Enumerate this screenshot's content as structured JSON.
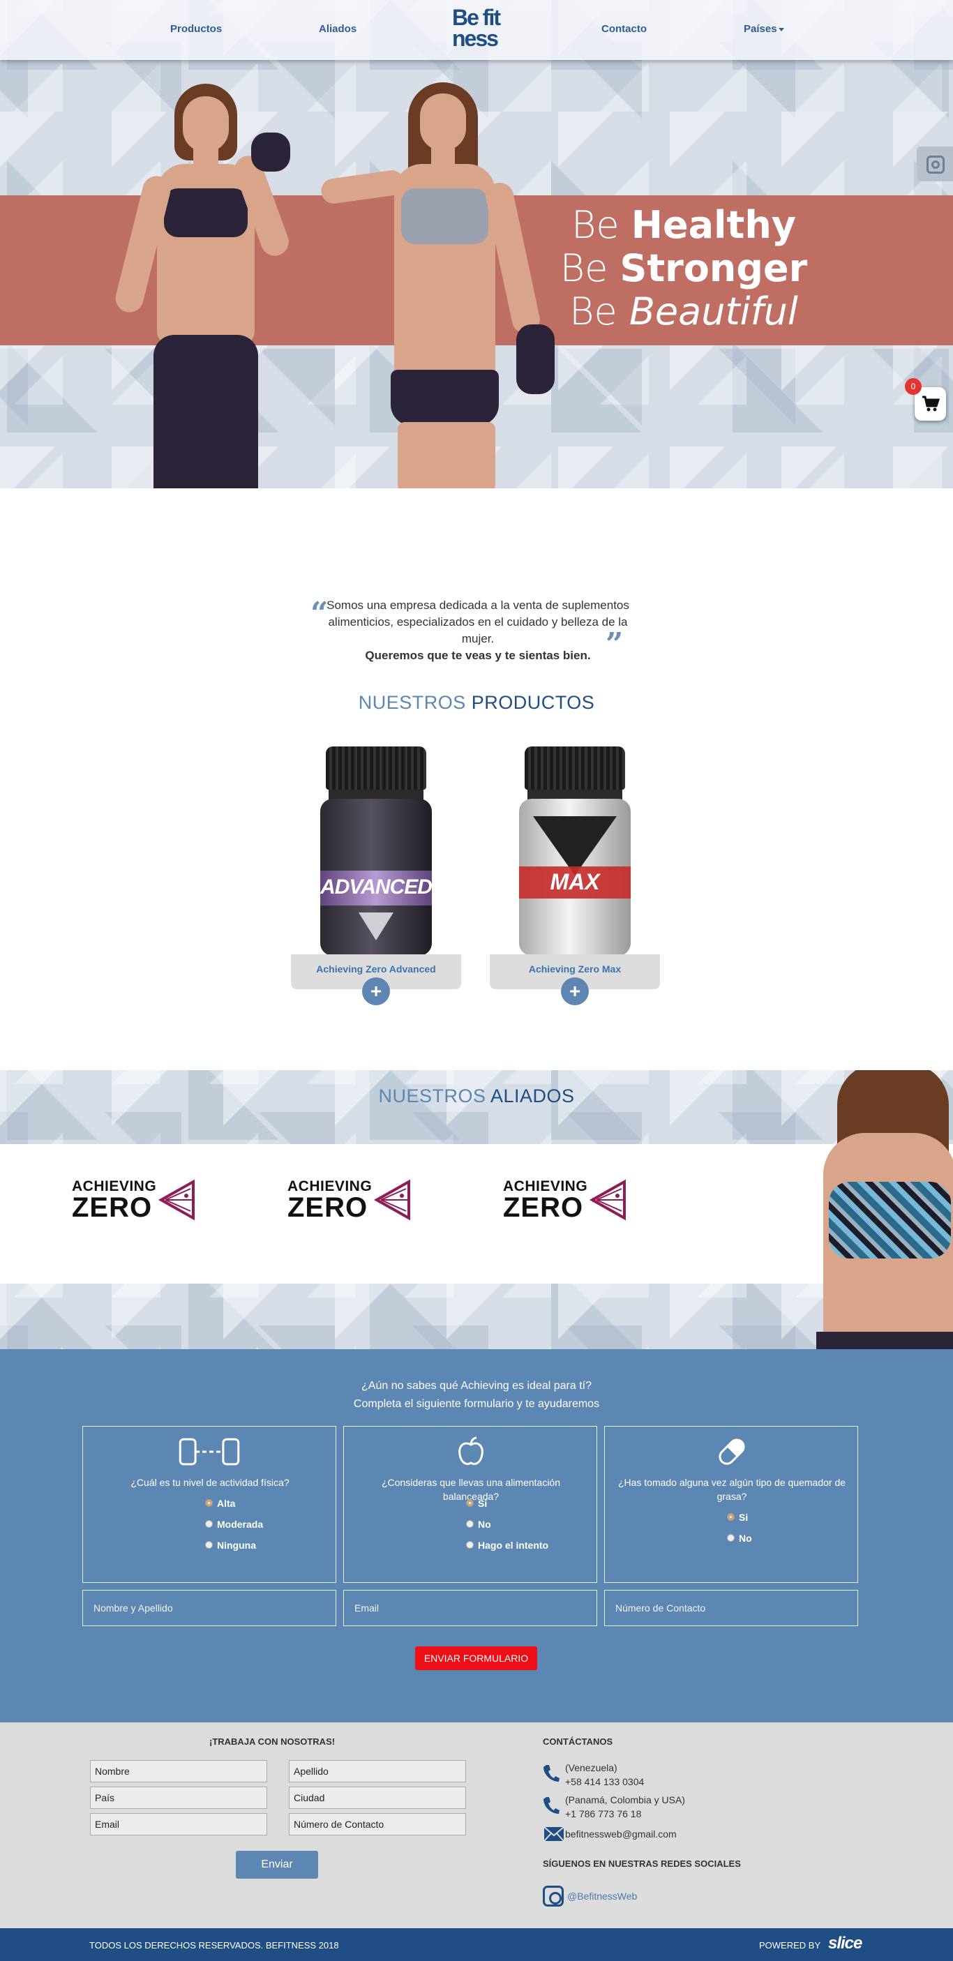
{
  "nav": {
    "productos": "Productos",
    "aliados": "Aliados",
    "logo_top": "Be fit",
    "logo_bottom": "ness",
    "contacto": "Contacto",
    "paises": "Países"
  },
  "hero": {
    "line1_a": "Be ",
    "line1_b": "Healthy",
    "line2_a": "Be ",
    "line2_b": "Stronger",
    "line3_a": "Be ",
    "line3_b": "Beautiful",
    "cart_count": "0"
  },
  "intro": {
    "text": "Somos una empresa dedicada a la venta de suplementos alimenticios, especializados en el cuidado y belleza de la mujer.",
    "bold": "Queremos que te veas y te sientas bien."
  },
  "products_title": {
    "light": "NUESTROS ",
    "bold": "PRODUCTOS"
  },
  "products": [
    {
      "name": "Achieving Zero Advanced",
      "label_text": "ADVANCED",
      "plus": "+"
    },
    {
      "name": "Achieving Zero Max",
      "label_text": "MAX",
      "plus": "+"
    }
  ],
  "aliados_title": {
    "light": "NUESTROS ",
    "bold": "ALIADOS"
  },
  "allies": [
    {
      "top": "ACHIEVING",
      "bottom": "ZERO"
    },
    {
      "top": "ACHIEVING",
      "bottom": "ZERO"
    },
    {
      "top": "ACHIEVING",
      "bottom": "ZERO"
    }
  ],
  "form": {
    "heading1": "¿Aún no sabes qué Achieving es ideal para tí?",
    "heading2": "Completa el siguiente formulario y te ayudaremos",
    "q1": "¿Cuál es tu nivel de actividad física?",
    "q1_opts": [
      "Alta",
      "Moderada",
      "Ninguna"
    ],
    "q2": "¿Consideras que llevas una alimentación balanceada?",
    "q2_opts": [
      "Si",
      "No",
      "Hago el intento"
    ],
    "q3": "¿Has tomado alguna vez algún tipo de quemador de grasa?",
    "q3_opts": [
      "Si",
      "No"
    ],
    "name_ph": "Nombre y Apellido",
    "email_ph": "Email",
    "phone_ph": "Número de Contacto",
    "submit": "ENVIAR FORMULARIO"
  },
  "work": {
    "title": "¡TRABAJA CON NOSOTRAS!",
    "nombre": "Nombre",
    "apellido": "Apellido",
    "pais": "País",
    "ciudad": "Ciudad",
    "email": "Email",
    "numero": "Número de Contacto",
    "submit": "Enviar"
  },
  "contact": {
    "title": "CONTÁCTANOS",
    "ve_label": "(Venezuela)",
    "ve_phone": "+58 414 133 0304",
    "us_label": "(Panamá, Colombia y USA)",
    "us_phone": "+1 786 773 76 18",
    "email": "befitnessweb@gmail.com",
    "social_title": "SÍGUENOS EN NUESTRAS REDES SOCIALES",
    "instagram": "@BefitnessWeb"
  },
  "footer": {
    "rights": "TODOS LOS DERECHOS RESERVADOS. BEFITNESS 2018",
    "powered": "POWERED BY",
    "brand": "slice"
  },
  "colors": {
    "navy": "#1f4e85",
    "steel_blue": "#5d87b3",
    "band_red": "#be6e63",
    "send_red": "#ee0e16",
    "footer_grey": "#dcdcdc"
  }
}
